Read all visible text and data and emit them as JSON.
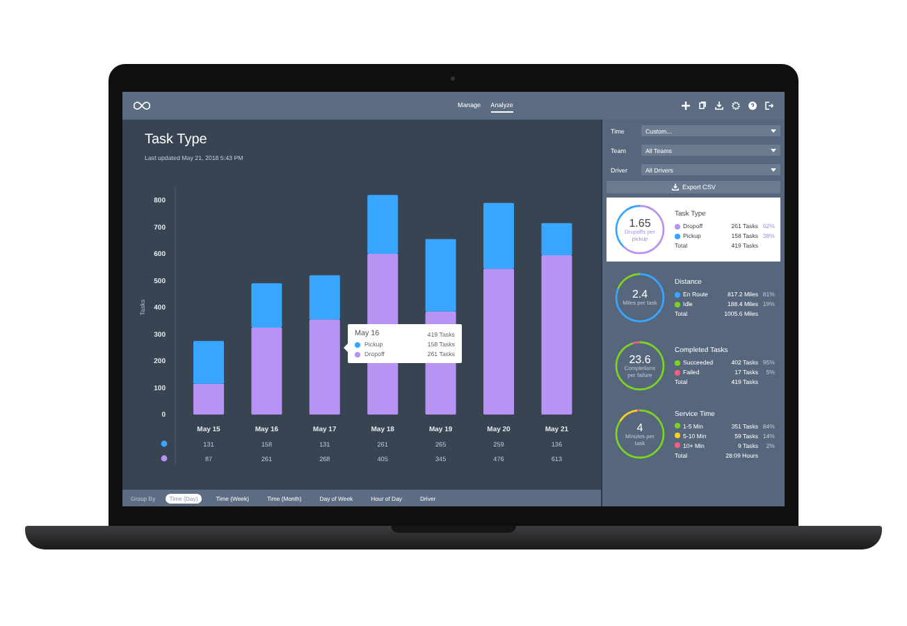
{
  "header": {
    "tabs": [
      {
        "label": "Manage",
        "selected": false
      },
      {
        "label": "Analyze",
        "selected": true
      }
    ]
  },
  "report": {
    "title": "Task Type",
    "updated": "Last updated May 21, 2018 5:43 PM",
    "chart_data": {
      "type": "bar",
      "stacked": true,
      "ylabel": "Tasks",
      "categories": [
        "May 15",
        "May 16",
        "May 17",
        "May 18",
        "May 19",
        "May 20",
        "May 21"
      ],
      "ylim": [
        0,
        850
      ],
      "yticks": [
        0,
        100,
        200,
        300,
        400,
        500,
        600,
        700,
        800
      ],
      "series": [
        {
          "color": "#b794f4",
          "values": [
            115,
            325,
            355,
            600,
            385,
            545,
            595
          ]
        },
        {
          "color": "#38a6ff",
          "values": [
            160,
            165,
            165,
            220,
            270,
            245,
            120
          ]
        }
      ]
    },
    "rows": [
      {
        "color": "#38a6ff",
        "values": [
          "131",
          "158",
          "131",
          "261",
          "265",
          "259",
          "136"
        ]
      },
      {
        "color": "#b794f4",
        "values": [
          "87",
          "261",
          "268",
          "405",
          "345",
          "476",
          "613"
        ]
      }
    ],
    "tooltip": {
      "title": "May 16",
      "total": "419 Tasks",
      "items": [
        {
          "label": "Pickup",
          "value": "158 Tasks",
          "color": "#38a6ff"
        },
        {
          "label": "Dropoff",
          "value": "261 Tasks",
          "color": "#b794f4"
        }
      ]
    },
    "group_by": {
      "label": "Group By",
      "options": [
        {
          "label": "Time (Day)",
          "selected": true
        },
        {
          "label": "Time (Week)",
          "selected": false
        },
        {
          "label": "Time (Month)",
          "selected": false
        },
        {
          "label": "Day of Week",
          "selected": false
        },
        {
          "label": "Hour of Day",
          "selected": false
        },
        {
          "label": "Driver",
          "selected": false
        }
      ]
    }
  },
  "filters": [
    {
      "label": "Time",
      "value": "Custom..."
    },
    {
      "label": "Team",
      "value": "All Teams"
    },
    {
      "label": "Driver",
      "value": "All Drivers"
    }
  ],
  "export_button": "Export CSV",
  "cards": [
    {
      "title": "Task Type",
      "value": "1.65",
      "caption": "Dropoffs per pickup",
      "selected": true,
      "items": [
        {
          "label": "Dropoff",
          "value": "261 Tasks",
          "percent": "62%",
          "color": "#b794f4"
        },
        {
          "label": "Pickup",
          "value": "158 Tasks",
          "percent": "38%",
          "color": "#38a6ff"
        }
      ],
      "total_label": "Total",
      "total": "419 Tasks"
    },
    {
      "title": "Distance",
      "value": "2.4",
      "caption": "Miles per task",
      "selected": false,
      "items": [
        {
          "label": "En Route",
          "value": "817.2 Miles",
          "percent": "81%",
          "color": "#38a6ff"
        },
        {
          "label": "Idle",
          "value": "188.4 Miles",
          "percent": "19%",
          "color": "#7ed321"
        }
      ],
      "total_label": "Total",
      "total": "1005.6 Miles"
    },
    {
      "title": "Completed Tasks",
      "value": "23.6",
      "caption": "Completions per failure",
      "selected": false,
      "items": [
        {
          "label": "Succeeded",
          "value": "402 Tasks",
          "percent": "95%",
          "color": "#7ed321"
        },
        {
          "label": "Failed",
          "value": "17 Tasks",
          "percent": "5%",
          "color": "#f25f7a"
        }
      ],
      "total_label": "Total",
      "total": "419 Tasks"
    },
    {
      "title": "Service Time",
      "value": "4",
      "caption": "Minutes per task",
      "selected": false,
      "items": [
        {
          "label": "1-5 Min",
          "value": "351 Tasks",
          "percent": "84%",
          "color": "#7ed321"
        },
        {
          "label": "5-10 Min",
          "value": "59 Tasks",
          "percent": "14%",
          "color": "#f8d21c"
        },
        {
          "label": "10+ Min",
          "value": "9 Tasks",
          "percent": "2%",
          "color": "#f25f7a"
        }
      ],
      "total_label": "Total",
      "total": "28:09 Hours"
    }
  ]
}
